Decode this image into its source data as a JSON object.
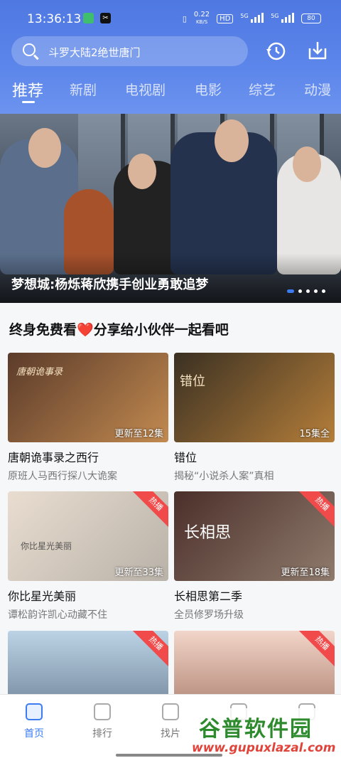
{
  "status_bar": {
    "time": "13:36:13",
    "speed_value": "0.22",
    "speed_unit": "KB/S",
    "hd_badge": "HD",
    "signal1": "5G",
    "signal2": "5G",
    "battery": "80"
  },
  "search": {
    "placeholder": "斗罗大陆2绝世唐门"
  },
  "tabs": [
    {
      "label": "推荐",
      "active": true
    },
    {
      "label": "新剧"
    },
    {
      "label": "电视剧"
    },
    {
      "label": "电影"
    },
    {
      "label": "综艺"
    },
    {
      "label": "动漫"
    }
  ],
  "banner": {
    "caption": "梦想城:杨烁蒋欣携手创业勇敢追梦",
    "page_count": 5,
    "active_page": 1
  },
  "section": {
    "title_prefix": "终身免费看",
    "heart": "❤️",
    "title_suffix": "分享给小伙伴一起看吧"
  },
  "cards": [
    {
      "title": "唐朝诡事录之西行",
      "subtitle": "原班人马西行探八大诡案",
      "episode": "更新至12集",
      "tag": "",
      "colors": [
        "#5b3b2a",
        "#c28a50"
      ],
      "overlay_text": "唐朝诡事录"
    },
    {
      "title": "错位",
      "subtitle": "揭秘“小说杀人案”真相",
      "episode": "15集全",
      "tag": "",
      "colors": [
        "#3a3022",
        "#b57e3a"
      ],
      "overlay_text": "错位"
    },
    {
      "title": "你比星光美丽",
      "subtitle": "谭松韵许凯心动藏不住",
      "episode": "更新至33集",
      "tag": "热播",
      "colors": [
        "#e9ddd0",
        "#b9b2a8"
      ],
      "overlay_text": "你比星光美丽"
    },
    {
      "title": "长相思第二季",
      "subtitle": "全员修罗场升级",
      "episode": "更新至18集",
      "tag": "热播",
      "colors": [
        "#4b2f2a",
        "#8f7b6d"
      ],
      "overlay_text": "长相思"
    },
    {
      "title": "",
      "subtitle": "",
      "episode": "",
      "tag": "热播",
      "colors": [
        "#bcd3e6",
        "#6b7f93"
      ],
      "overlay_text": ""
    },
    {
      "title": "",
      "subtitle": "",
      "episode": "",
      "tag": "热播",
      "colors": [
        "#f2d5c9",
        "#a97b6a"
      ],
      "overlay_text": ""
    }
  ],
  "bottom_nav": [
    {
      "label": "首页",
      "icon": "home-icon",
      "active": true
    },
    {
      "label": "排行",
      "icon": "ranking-icon"
    },
    {
      "label": "找片",
      "icon": "video-icon"
    },
    {
      "label": "",
      "icon": "vip-icon"
    },
    {
      "label": "",
      "icon": "profile-icon"
    }
  ],
  "watermark": {
    "logo": "谷普软件园",
    "url": "www.gupuxlazal.com"
  }
}
